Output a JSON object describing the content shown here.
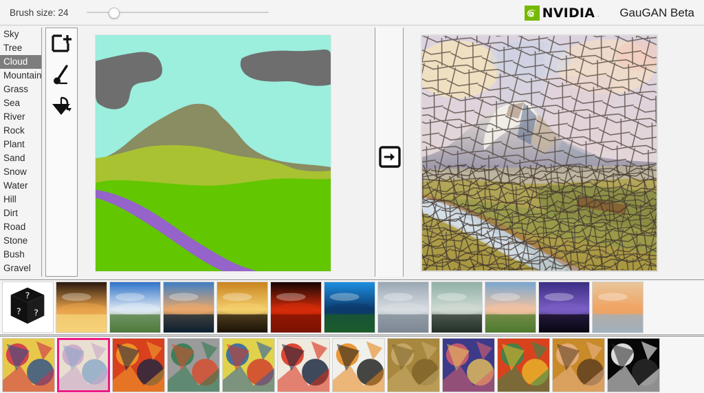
{
  "toolbar": {
    "brush_label": "Brush size: 24",
    "brush_value": 24,
    "slider_percent": 15,
    "brand_name": "NVIDIA",
    "brand_tm": ".",
    "app_title": "GauGAN Beta",
    "brand_color": "#76b900"
  },
  "labels": {
    "selected": "Cloud",
    "items": [
      {
        "name": "Sky",
        "color": "#9ceedd"
      },
      {
        "name": "Tree",
        "color": "#3f7a3f"
      },
      {
        "name": "Cloud",
        "color": "#6e6e6e"
      },
      {
        "name": "Mountain",
        "color": "#8a8c62"
      },
      {
        "name": "Grass",
        "color": "#62c600"
      },
      {
        "name": "Sea",
        "color": "#2a6fb0"
      },
      {
        "name": "River",
        "color": "#9563c9"
      },
      {
        "name": "Rock",
        "color": "#8a8178"
      },
      {
        "name": "Plant",
        "color": "#4fae4f"
      },
      {
        "name": "Sand",
        "color": "#d9c98a"
      },
      {
        "name": "Snow",
        "color": "#f0f0f0"
      },
      {
        "name": "Water",
        "color": "#4a9bd4"
      },
      {
        "name": "Hill",
        "color": "#a8c232"
      },
      {
        "name": "Dirt",
        "color": "#9a7b52"
      },
      {
        "name": "Road",
        "color": "#808080"
      },
      {
        "name": "Stone",
        "color": "#9e9e9e"
      },
      {
        "name": "Bush",
        "color": "#5d9c4a"
      },
      {
        "name": "Gravel",
        "color": "#b5ada0"
      }
    ]
  },
  "tools": [
    {
      "id": "new-canvas",
      "icon": "new-canvas-icon",
      "title": "New canvas"
    },
    {
      "id": "pen",
      "icon": "pen-icon",
      "title": "Pen"
    },
    {
      "id": "fill",
      "icon": "fill-bucket-icon",
      "title": "Fill bucket"
    }
  ],
  "canvas": {
    "segmentation": {
      "title": "Segmentation canvas",
      "sky_color": "#9ceedd",
      "cloud_color": "#6e6e6e",
      "mountain_color": "#8a8c62",
      "hill_color": "#a8c232",
      "grass_color": "#62c600",
      "river_color": "#9563c9"
    },
    "output": {
      "title": "Generated output",
      "style": "stained-glass mountain landscape"
    },
    "generate_icon": "arrow-right-icon",
    "download_icon": "download-icon"
  },
  "strips": {
    "scenes": {
      "title": "Scene presets",
      "items": [
        {
          "id": "random",
          "caption": "random",
          "icon": "dice-question-icon"
        },
        {
          "id": "scene-1",
          "caption": "sunset with tree silhouette",
          "c1": "#2a1a10",
          "c2": "#e8a24a",
          "c3": "#f5d37a"
        },
        {
          "id": "scene-2",
          "caption": "highway under blue sky with clouds",
          "c1": "#2f74c9",
          "c2": "#dfe9f3",
          "c3": "#4e7a3a"
        },
        {
          "id": "scene-3",
          "caption": "pier at dusk over calm sea",
          "c1": "#3f7fc4",
          "c2": "#e9a86b",
          "c3": "#0d2030"
        },
        {
          "id": "scene-4",
          "caption": "golden sunset over water",
          "c1": "#c98420",
          "c2": "#f4cf6c",
          "c3": "#1d1207"
        },
        {
          "id": "scene-5",
          "caption": "deep red sunset",
          "c1": "#160604",
          "c2": "#d62b0a",
          "c3": "#7d1203"
        },
        {
          "id": "scene-6",
          "caption": "tropical bay with blue sky",
          "c1": "#1d8fe0",
          "c2": "#0c3a6b",
          "c3": "#1c5c2a"
        },
        {
          "id": "scene-7",
          "caption": "overcast beach",
          "c1": "#9aa7b4",
          "c2": "#d7dde2",
          "c3": "#7d8894"
        },
        {
          "id": "scene-8",
          "caption": "beach with tree and flare",
          "c1": "#8fb0a6",
          "c2": "#cfdad2",
          "c3": "#243028"
        },
        {
          "id": "scene-9",
          "caption": "pink clouds over grass field",
          "c1": "#7aa7cf",
          "c2": "#f2c2a1",
          "c3": "#4d7a2e"
        },
        {
          "id": "scene-10",
          "caption": "purple twilight reflection",
          "c1": "#3b2d84",
          "c2": "#7a5ec4",
          "c3": "#0a0612"
        },
        {
          "id": "scene-11",
          "caption": "hazy sunset over sea",
          "c1": "#e8c59a",
          "c2": "#f0a463",
          "c3": "#9fb0bd"
        }
      ]
    },
    "styles": {
      "title": "Style presets",
      "selected_index": 1,
      "items": [
        {
          "id": "style-1",
          "caption": "colorful abstract circles",
          "c1": "#e8c84a",
          "c2": "#cf2e4c",
          "c3": "#2a4f8a"
        },
        {
          "id": "style-2",
          "caption": "pastel art nouveau mosaic",
          "c1": "#e8dfd0",
          "c2": "#c8a6c8",
          "c3": "#8aa8c8"
        },
        {
          "id": "style-3",
          "caption": "woman with umbrella in rain",
          "c1": "#d8401e",
          "c2": "#f0a02a",
          "c3": "#1b2440"
        },
        {
          "id": "style-4",
          "caption": "grey cubist figures",
          "c1": "#9b9b9b",
          "c2": "#2f7a4e",
          "c3": "#d84a2a"
        },
        {
          "id": "style-5",
          "caption": "kandinsky composition",
          "c1": "#e0d24a",
          "c2": "#2a5fa8",
          "c3": "#d03a2a"
        },
        {
          "id": "style-6",
          "caption": "red handprint on white",
          "c1": "#efe9de",
          "c2": "#d92b15",
          "c3": "#12213a"
        },
        {
          "id": "style-7",
          "caption": "orange white abstract",
          "c1": "#f0f0ec",
          "c2": "#e8871a",
          "c3": "#1a1a1a"
        },
        {
          "id": "style-8",
          "caption": "golden textured disc",
          "c1": "#a8873f",
          "c2": "#c9ad6b",
          "c3": "#7d6229"
        },
        {
          "id": "style-9",
          "caption": "woman with hat portrait",
          "c1": "#3d3a8a",
          "c2": "#d8606a",
          "c3": "#e8c25a"
        },
        {
          "id": "style-10",
          "caption": "fauvist interior scene",
          "c1": "#d8431e",
          "c2": "#2f8a4e",
          "c3": "#e8b82a"
        },
        {
          "id": "style-11",
          "caption": "self portrait ochre",
          "c1": "#c98a2a",
          "c2": "#e8b286",
          "c3": "#5a3a1e"
        },
        {
          "id": "style-12",
          "caption": "white streaks on black",
          "c1": "#070707",
          "c2": "#ffffff",
          "c3": "#2a2a2a"
        }
      ]
    }
  }
}
